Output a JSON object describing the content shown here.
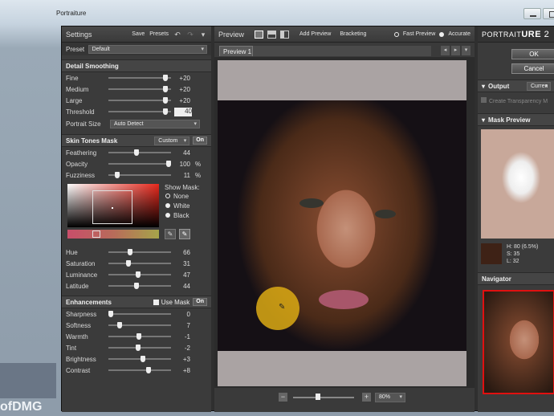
{
  "window": {
    "title": "Portraiture"
  },
  "left": {
    "header": {
      "title": "Settings",
      "save": "Save",
      "presets": "Presets"
    },
    "preset": {
      "label": "Preset",
      "value": "Default"
    },
    "detail": {
      "title": "Detail Smoothing",
      "rows": [
        {
          "label": "Fine",
          "value": "+20",
          "level": 0.95
        },
        {
          "label": "Medium",
          "value": "+20",
          "level": 0.95
        },
        {
          "label": "Large",
          "value": "+20",
          "level": 0.95
        },
        {
          "label": "Threshold",
          "value": "40",
          "level": 0.95
        }
      ],
      "portrait_size": {
        "label": "Portrait Size",
        "value": "Auto Detect"
      }
    },
    "skin": {
      "title": "Skin Tones Mask",
      "mode": "Custom",
      "toggle": "On",
      "rows": [
        {
          "label": "Feathering",
          "value": "44",
          "unit": "",
          "level": 0.44
        },
        {
          "label": "Opacity",
          "value": "100",
          "unit": "%",
          "level": 1.0
        },
        {
          "label": "Fuzziness",
          "value": "11",
          "unit": "%",
          "level": 0.11
        }
      ],
      "show_mask": {
        "label": "Show Mask:",
        "options": [
          "None",
          "White",
          "Black"
        ],
        "selected": "None"
      },
      "rows2": [
        {
          "label": "Hue",
          "value": "66",
          "level": 0.33
        },
        {
          "label": "Saturation",
          "value": "31",
          "level": 0.31
        },
        {
          "label": "Luminance",
          "value": "47",
          "level": 0.47
        },
        {
          "label": "Latitude",
          "value": "44",
          "level": 0.44
        }
      ]
    },
    "enh": {
      "title": "Enhancements",
      "use_mask": "Use Mask",
      "toggle": "On",
      "rows": [
        {
          "label": "Sharpness",
          "value": "0",
          "level": 0.0
        },
        {
          "label": "Softness",
          "value": "7",
          "level": 0.15
        },
        {
          "label": "Warmth",
          "value": "-1",
          "level": 0.48
        },
        {
          "label": "Tint",
          "value": "-2",
          "level": 0.47
        },
        {
          "label": "Brightness",
          "value": "+3",
          "level": 0.55
        },
        {
          "label": "Contrast",
          "value": "+8",
          "level": 0.65
        }
      ]
    }
  },
  "center": {
    "header": {
      "title": "Preview",
      "add_preview": "Add Preview",
      "bracketing": "Bracketing",
      "fast": "Fast Preview",
      "accurate": "Accurate"
    },
    "tab": "Preview 1",
    "zoom": "80%"
  },
  "right": {
    "brand_a": "PORTRAIT",
    "brand_b": "URE",
    "version": "2",
    "ok": "OK",
    "cancel": "Cancel",
    "output": {
      "title": "Output",
      "value": "Curren",
      "create": "Create Transparency M"
    },
    "mask_preview": {
      "title": "Mask Preview"
    },
    "readout": {
      "h": "H:  80 (6.5%)",
      "s": "S:  35",
      "l": "L:  32"
    },
    "navigator": {
      "title": "Navigator"
    }
  },
  "watermark": "ofDMG"
}
